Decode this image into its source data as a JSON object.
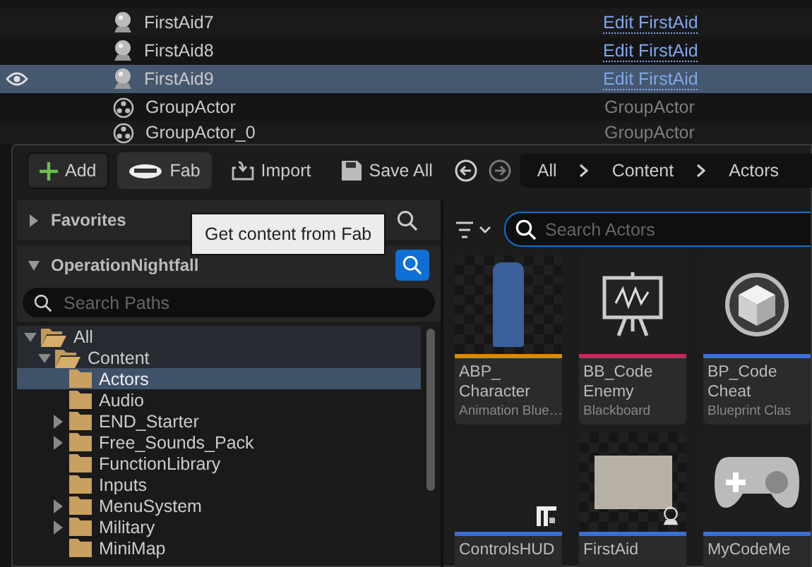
{
  "outliner": {
    "rows": [
      {
        "name": "FirstAid7",
        "kind": "actor",
        "type": "Edit FirstAid",
        "visible": false,
        "selected": false
      },
      {
        "name": "FirstAid8",
        "kind": "actor",
        "type": "Edit FirstAid",
        "visible": false,
        "selected": false
      },
      {
        "name": "FirstAid9",
        "kind": "actor",
        "type": "Edit FirstAid",
        "visible": true,
        "selected": true
      },
      {
        "name": "GroupActor",
        "kind": "group",
        "type": "GroupActor",
        "visible": false,
        "selected": false
      },
      {
        "name": "GroupActor_0",
        "kind": "group",
        "type": "GroupActor",
        "visible": false,
        "selected": false
      }
    ]
  },
  "toolbar": {
    "buttons": [
      {
        "label": "Add",
        "kind": "add"
      },
      {
        "label": "Fab",
        "kind": "fab"
      },
      {
        "label": "Import",
        "kind": "import"
      },
      {
        "label": "Save All",
        "kind": "save"
      }
    ],
    "breadcrumbs": [
      "All",
      "Content",
      "Actors"
    ]
  },
  "tooltip": "Get content from Fab",
  "favorites": {
    "title": "Favorites",
    "expanded": false
  },
  "project": {
    "title": "OperationNightfall",
    "expanded": true
  },
  "search_paths": {
    "placeholder": "Search Paths"
  },
  "tree": [
    {
      "name": "All",
      "kind": "open",
      "selected": false,
      "children": [
        {
          "name": "Content",
          "kind": "open",
          "selected": false,
          "children": [
            {
              "name": "Actors",
              "kind": "leaf",
              "selected": true
            },
            {
              "name": "Audio",
              "kind": "leaf",
              "selected": false
            },
            {
              "name": "END_Starter",
              "kind": "closed",
              "selected": false
            },
            {
              "name": "Free_Sounds_Pack",
              "kind": "closed",
              "selected": false
            },
            {
              "name": "FunctionLibrary",
              "kind": "leaf",
              "selected": false
            },
            {
              "name": "Inputs",
              "kind": "leaf",
              "selected": false
            },
            {
              "name": "MenuSystem",
              "kind": "closed",
              "selected": false
            },
            {
              "name": "Military",
              "kind": "closed",
              "selected": false
            },
            {
              "name": "MiniMap",
              "kind": "leaf",
              "selected": false
            }
          ]
        }
      ]
    }
  ],
  "search_actors": {
    "placeholder": "Search Actors"
  },
  "assets": [
    {
      "name": "ABP_ Character",
      "type": "Animation Blue…",
      "kind": "figure",
      "color": "#d98c00"
    },
    {
      "name": "BB_Code Enemy",
      "type": "Blackboard",
      "kind": "easel",
      "color": "#c8285a"
    },
    {
      "name": "BP_Code Cheat",
      "type": "Blueprint Clas",
      "kind": "cube",
      "color": "#3a6fd8"
    },
    {
      "name": "ControlsHUD",
      "kind": "widget",
      "color": "#3a6fd8"
    },
    {
      "name": "FirstAid",
      "kind": "crate",
      "color": "#3a6fd8"
    },
    {
      "name": "MyCodeMe",
      "kind": "gamepad",
      "color": "#3a6fd8"
    }
  ]
}
